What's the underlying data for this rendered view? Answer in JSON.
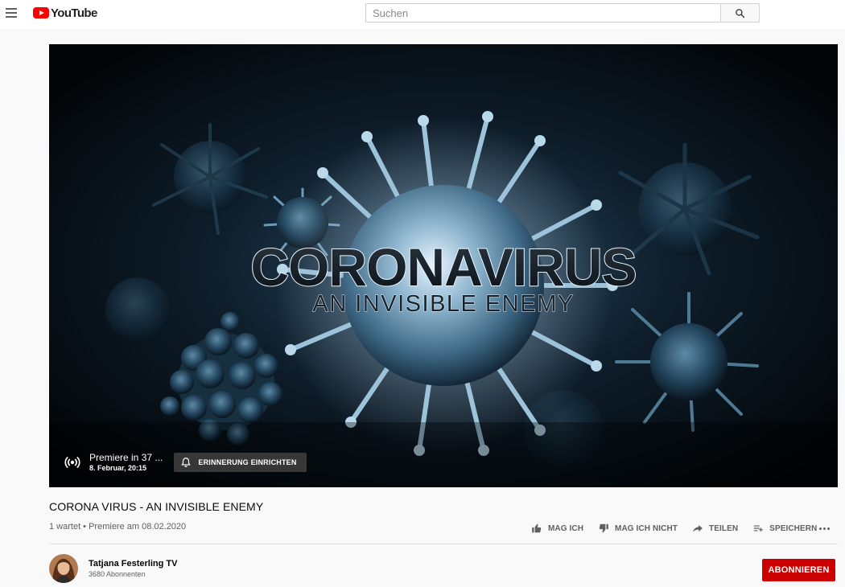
{
  "masthead": {
    "logo_text": "YouTube",
    "search_placeholder": "Suchen"
  },
  "player": {
    "thumbnail_text_line1": "CORONAVIRUS",
    "thumbnail_text_line1_a": "CORONA",
    "thumbnail_text_line1_b": "VIRUS",
    "thumbnail_text_line2": "AN INVISIBLE ENEMY",
    "premiere_title": "Premiere in 37 ...",
    "premiere_date": "8. Februar, 20:15",
    "reminder_label": "ERINNERUNG EINRICHTEN"
  },
  "video": {
    "title": "CORONA VIRUS - AN INVISIBLE ENEMY",
    "meta": "1 wartet • Premiere am 08.02.2020"
  },
  "actions": {
    "like": "MAG ICH",
    "dislike": "MAG ICH NICHT",
    "share": "TEILEN",
    "save": "SPEICHERN"
  },
  "owner": {
    "channel_name": "Tatjana Festerling TV",
    "subscribers": "3680 Abonnenten",
    "subscribe_label": "ABONNIEREN"
  },
  "colors": {
    "brand_red": "#ff0000",
    "subscribe_red": "#cc0000",
    "text_secondary": "#606060",
    "page_bg": "#f9f9f9"
  }
}
